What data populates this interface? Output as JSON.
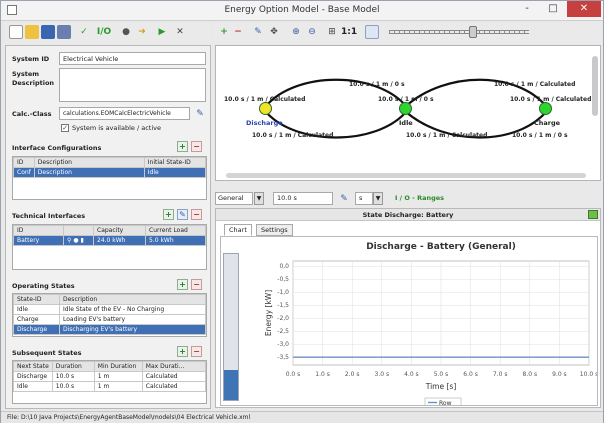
{
  "window": {
    "title": "Energy Option Model - Base Model",
    "minimize": "-",
    "restore": "□",
    "close": "✕"
  },
  "toolbar_left": {
    "labels": [
      "I/O"
    ]
  },
  "toolbar_right": {
    "zoom_ratio": "1:1"
  },
  "system": {
    "id_label": "System ID",
    "id_value": "Electrical Vehicle",
    "desc_label": "System Description",
    "desc_value": "",
    "class_label": "Calc.-Class",
    "class_value": "calculations.EOMCalcElectricVehicle",
    "available_label": "System is available / active",
    "available_checked": true
  },
  "interface_configs": {
    "title": "Interface Configurations",
    "columns": [
      "ID",
      "Description",
      "Initial State-ID"
    ],
    "rows": [
      [
        "Conf",
        "Description",
        "Idle"
      ]
    ]
  },
  "technical_interfaces": {
    "title": "Technical Interfaces",
    "columns": [
      "ID",
      "",
      "Capacity",
      "Current Load"
    ],
    "rows": [
      [
        "Battery",
        "",
        "24.0 kWh",
        "5.0 kWh"
      ]
    ]
  },
  "operating_states": {
    "title": "Operating States",
    "columns": [
      "State-ID",
      "Description"
    ],
    "rows": [
      [
        "Idle",
        "Idle State of the EV - No Charging"
      ],
      [
        "Charge",
        "Loading EV's battery"
      ],
      [
        "Discharge",
        "Discharging EV's battery"
      ]
    ]
  },
  "subsequent_states": {
    "title": "Subsequent States",
    "columns": [
      "Next State",
      "Duration",
      "Min Duration",
      "Max Durati..."
    ],
    "rows": [
      [
        "Discharge",
        "10.0 s",
        "1 m",
        "Calculated"
      ],
      [
        "Idle",
        "10.0 s",
        "1 m",
        "Calculated"
      ]
    ]
  },
  "graph": {
    "nodes": [
      {
        "name": "Discharge",
        "color": "#f2e22a"
      },
      {
        "name": "Idle",
        "color": "#2fd42f"
      },
      {
        "name": "Charge",
        "color": "#2fd42f"
      }
    ],
    "edge_labels": [
      "10.0 s / 1 m / 0 s",
      "10.0 s / 1 m / Calculated",
      "10.0 s / 1 m / Calculated",
      "10.0 s / 1 m / 0 s",
      "10.0 s / 1 m / Calculated",
      "10.0 s / 1 m / Calculated",
      "10.0 s / 1 m / Calculated",
      "10.0 s / 1 m / 0 s"
    ]
  },
  "controls": {
    "view": "General",
    "time_value": "10.0 s",
    "unit": "s",
    "io_ranges": "I / O - Ranges"
  },
  "state_panel": {
    "title": "State Discharge: Battery",
    "tabs": [
      "Chart",
      "Settings"
    ]
  },
  "chart_data": {
    "type": "line",
    "title": "Discharge - Battery (General)",
    "xlabel": "Time [s]",
    "ylabel": "Energy [kW]",
    "x_ticks": [
      "0.0 s",
      "1.0 s",
      "2.0 s",
      "3.0 s",
      "4.0 s",
      "5.0 s",
      "6.0 s",
      "7.0 s",
      "8.0 s",
      "9.0 s",
      "10.0 s"
    ],
    "y_ticks": [
      "0,0",
      "-0,5",
      "-1,0",
      "-1,5",
      "-2,0",
      "-2,5",
      "-3,0",
      "-3,5"
    ],
    "xlim": [
      0,
      10
    ],
    "ylim": [
      -3.8,
      0.2
    ],
    "series": [
      {
        "name": "Row",
        "x": [
          0,
          10
        ],
        "y": [
          -3.5,
          -3.5
        ],
        "color": "#6f8fc7"
      }
    ],
    "legend": "bottom"
  },
  "status_bar": {
    "file": "File: D:\\10 Java Projects\\EnergyAgentBaseModel\\models\\04 Electrical Vehicle.xml"
  }
}
